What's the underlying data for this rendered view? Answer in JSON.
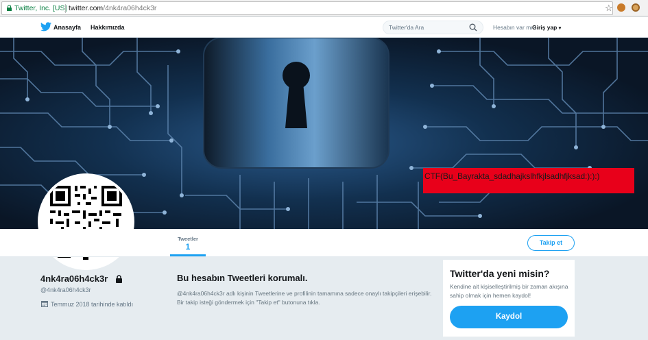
{
  "browser": {
    "site_identity": "Twitter, Inc. [US]",
    "url_host": "twitter.com",
    "url_path": "/4nk4ra06h4ck3r"
  },
  "nav": {
    "home": "Anasayfa",
    "about": "Hakkımızda",
    "search_placeholder": "Twitter'da Ara",
    "account_question": "Hesabın var mı?",
    "login": "Giriş yap"
  },
  "banner": {
    "flag_text": "CTF(Bu_Bayrakta_sdadhajkslhfkjlsadhfjksad:):):)"
  },
  "profile_nav": {
    "tweets_label": "Tweetler",
    "tweets_count": "1",
    "follow_button": "Takip et"
  },
  "profile": {
    "name": "4nk4ra06h4ck3r",
    "handle": "@4nk4ra06h4ck3r",
    "joined": "Temmuz 2018 tarihinde katıldı"
  },
  "protected_notice": {
    "title": "Bu hesabın Tweetleri korumalı.",
    "description": "@4nk4ra06h4ck3r adlı kişinin Tweetlerine ve profilinin tamamına sadece onaylı takipçileri erişebilir. Bir takip isteği göndermek için \"Takip et\" butonuna tıkla."
  },
  "signup_card": {
    "title": "Twitter'da yeni misin?",
    "description": "Kendine ait kişiselleştirilmiş bir zaman akışına sahip olmak için hemen kaydol!",
    "button": "Kaydol"
  },
  "colors": {
    "twitter_blue": "#1da1f2",
    "flag_red": "#e8001a",
    "secure_green": "#0b8043"
  }
}
